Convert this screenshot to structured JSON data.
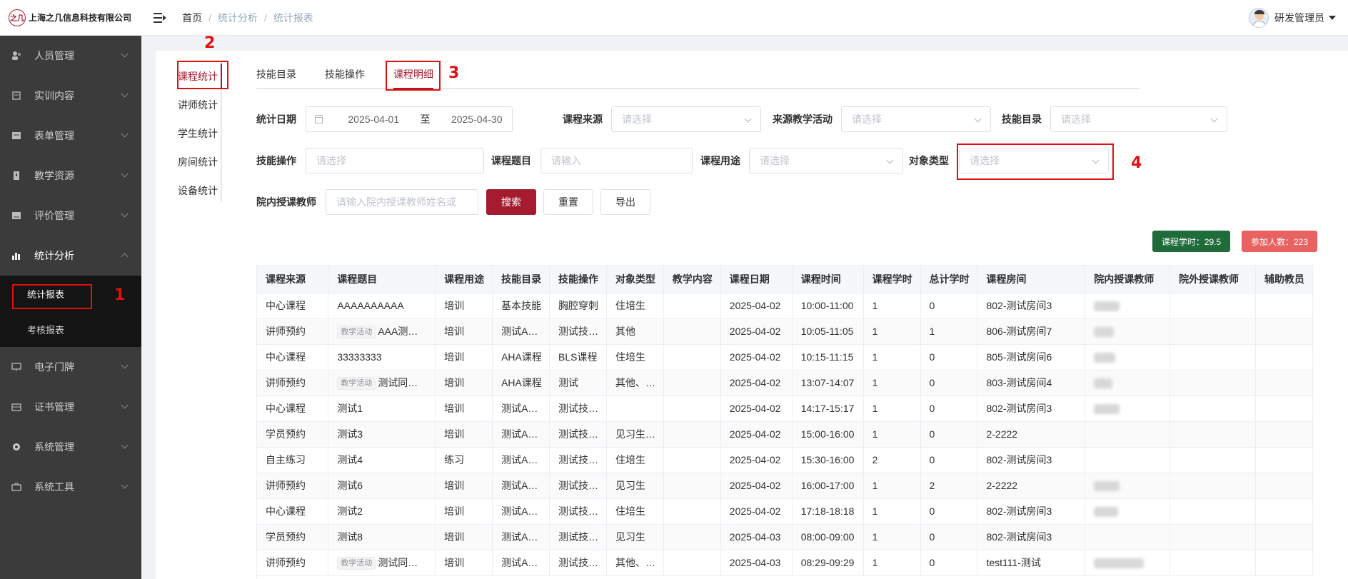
{
  "company": {
    "name": "上海之几信息科技有限公司",
    "logo_text": "之几"
  },
  "sidebar": {
    "items": [
      {
        "label": "人员管理",
        "icon": "users-icon"
      },
      {
        "label": "实训内容",
        "icon": "training-icon"
      },
      {
        "label": "表单管理",
        "icon": "form-icon"
      },
      {
        "label": "教学资源",
        "icon": "resource-icon"
      },
      {
        "label": "评价管理",
        "icon": "evaluation-icon"
      },
      {
        "label": "统计分析",
        "icon": "chart-icon"
      },
      {
        "label": "电子门牌",
        "icon": "monitor-icon"
      },
      {
        "label": "证书管理",
        "icon": "certificate-icon"
      },
      {
        "label": "系统管理",
        "icon": "gear-icon"
      },
      {
        "label": "系统工具",
        "icon": "toolbox-icon"
      }
    ],
    "submenu": [
      {
        "label": "统计报表",
        "active": true
      },
      {
        "label": "考核报表",
        "active": false
      }
    ]
  },
  "breadcrumb": {
    "home": "首页",
    "section": "统计分析",
    "current": "统计报表",
    "separator": "/"
  },
  "user": {
    "name": "研发管理员"
  },
  "side_tabs": [
    "课程统计",
    "讲师统计",
    "学生统计",
    "房间统计",
    "设备统计"
  ],
  "top_tabs": [
    "技能目录",
    "技能操作",
    "课程明细"
  ],
  "filters": {
    "date_label": "统计日期",
    "date_start": "2025-04-01",
    "date_sep": "至",
    "date_end": "2025-04-30",
    "course_source_label": "课程来源",
    "teaching_activity_label": "来源教学活动",
    "skill_catalog_label": "技能目录",
    "skill_operation_label": "技能操作",
    "course_title_label": "课程题目",
    "course_use_label": "课程用途",
    "target_type_label": "对象类型",
    "teacher_label": "院内授课教师",
    "select_placeholder": "请选择",
    "input_placeholder": "请输入",
    "teacher_placeholder": "请输入院内授课教师姓名或"
  },
  "buttons": {
    "search": "搜索",
    "reset": "重置",
    "export": "导出"
  },
  "stats": {
    "hours": "课程学时：29.5",
    "participants": "参加人数：223"
  },
  "colors": {
    "accent": "#a51c30",
    "sidebar_bg": "#3b3b3b",
    "stat_green": "#1f6b3a",
    "stat_red": "#e86262",
    "annotation": "#e01010"
  },
  "annotations": [
    "1",
    "2",
    "3",
    "4"
  ],
  "table": {
    "headers": [
      "课程来源",
      "课程题目",
      "课程用途",
      "技能目录",
      "技能操作",
      "对象类型",
      "教学内容",
      "课程日期",
      "课程时间",
      "课程学时",
      "总计学时",
      "课程房间",
      "院内授课教师",
      "院外授课教师",
      "辅助教员"
    ],
    "rows": [
      {
        "source": "中心课程",
        "tag": "",
        "title": "AAAAAAAAAA",
        "use": "培训",
        "catalog": "基本技能",
        "operation": "胸腔穿刺",
        "target": "住培生",
        "content": "",
        "date": "2025-04-02",
        "time": "10:00-11:00",
        "hours": "1",
        "total": "0",
        "room": "802-测试房间3",
        "inner_teacher_blurred": true
      },
      {
        "source": "讲师预约",
        "tag": "教学活动",
        "title": "AAA测…",
        "use": "培训",
        "catalog": "测试A…",
        "operation": "测试技…",
        "target": "其他",
        "content": "",
        "date": "2025-04-02",
        "time": "10:05-11:05",
        "hours": "1",
        "total": "1",
        "room": "806-测试房间7",
        "inner_teacher_blurred": true
      },
      {
        "source": "中心课程",
        "tag": "",
        "title": "33333333",
        "use": "培训",
        "catalog": "AHA课程",
        "operation": "BLS课程",
        "target": "住培生",
        "content": "",
        "date": "2025-04-02",
        "time": "10:15-11:15",
        "hours": "1",
        "total": "0",
        "room": "805-测试房间6",
        "inner_teacher_blurred": true
      },
      {
        "source": "讲师预约",
        "tag": "教学活动",
        "title": "测试同…",
        "use": "培训",
        "catalog": "AHA课程",
        "operation": "测试",
        "target": "其他、…",
        "content": "",
        "date": "2025-04-02",
        "time": "13:07-14:07",
        "hours": "1",
        "total": "0",
        "room": "803-测试房间4",
        "inner_teacher_blurred": true
      },
      {
        "source": "中心课程",
        "tag": "",
        "title": "测试1",
        "use": "培训",
        "catalog": "测试A…",
        "operation": "测试技…",
        "target": "",
        "content": "",
        "date": "2025-04-02",
        "time": "14:17-15:17",
        "hours": "1",
        "total": "0",
        "room": "802-测试房间3",
        "inner_teacher_blurred": true
      },
      {
        "source": "学员预约",
        "tag": "",
        "title": "测试3",
        "use": "培训",
        "catalog": "测试A…",
        "operation": "测试技…",
        "target": "见习生…",
        "content": "",
        "date": "2025-04-02",
        "time": "15:00-16:00",
        "hours": "1",
        "total": "0",
        "room": "2-2222",
        "inner_teacher_blurred": false
      },
      {
        "source": "自主练习",
        "tag": "",
        "title": "测试4",
        "use": "练习",
        "catalog": "测试A…",
        "operation": "测试技…",
        "target": "住培生",
        "content": "",
        "date": "2025-04-02",
        "time": "15:30-16:00",
        "hours": "2",
        "total": "0",
        "room": "802-测试房间3",
        "inner_teacher_blurred": false
      },
      {
        "source": "讲师预约",
        "tag": "",
        "title": "测试6",
        "use": "培训",
        "catalog": "测试A…",
        "operation": "测试技…",
        "target": "见习生",
        "content": "",
        "date": "2025-04-02",
        "time": "16:00-17:00",
        "hours": "1",
        "total": "2",
        "room": "2-2222",
        "inner_teacher_blurred": true
      },
      {
        "source": "中心课程",
        "tag": "",
        "title": "测试2",
        "use": "培训",
        "catalog": "测试A…",
        "operation": "测试技…",
        "target": "住培生",
        "content": "",
        "date": "2025-04-02",
        "time": "17:18-18:18",
        "hours": "1",
        "total": "0",
        "room": "802-测试房间3",
        "inner_teacher_blurred": true
      },
      {
        "source": "学员预约",
        "tag": "",
        "title": "测试8",
        "use": "培训",
        "catalog": "测试A…",
        "operation": "测试技…",
        "target": "见习生",
        "content": "",
        "date": "2025-04-03",
        "time": "08:00-09:00",
        "hours": "1",
        "total": "0",
        "room": "802-测试房间3",
        "inner_teacher_blurred": false
      },
      {
        "source": "讲师预约",
        "tag": "教学活动",
        "title": "测试同…",
        "use": "培训",
        "catalog": "测试A…",
        "operation": "测试技…",
        "target": "其他、…",
        "content": "",
        "date": "2025-04-03",
        "time": "08:29-09:29",
        "hours": "1",
        "total": "0",
        "room": "test111-测试",
        "inner_teacher_blurred": true
      }
    ]
  }
}
